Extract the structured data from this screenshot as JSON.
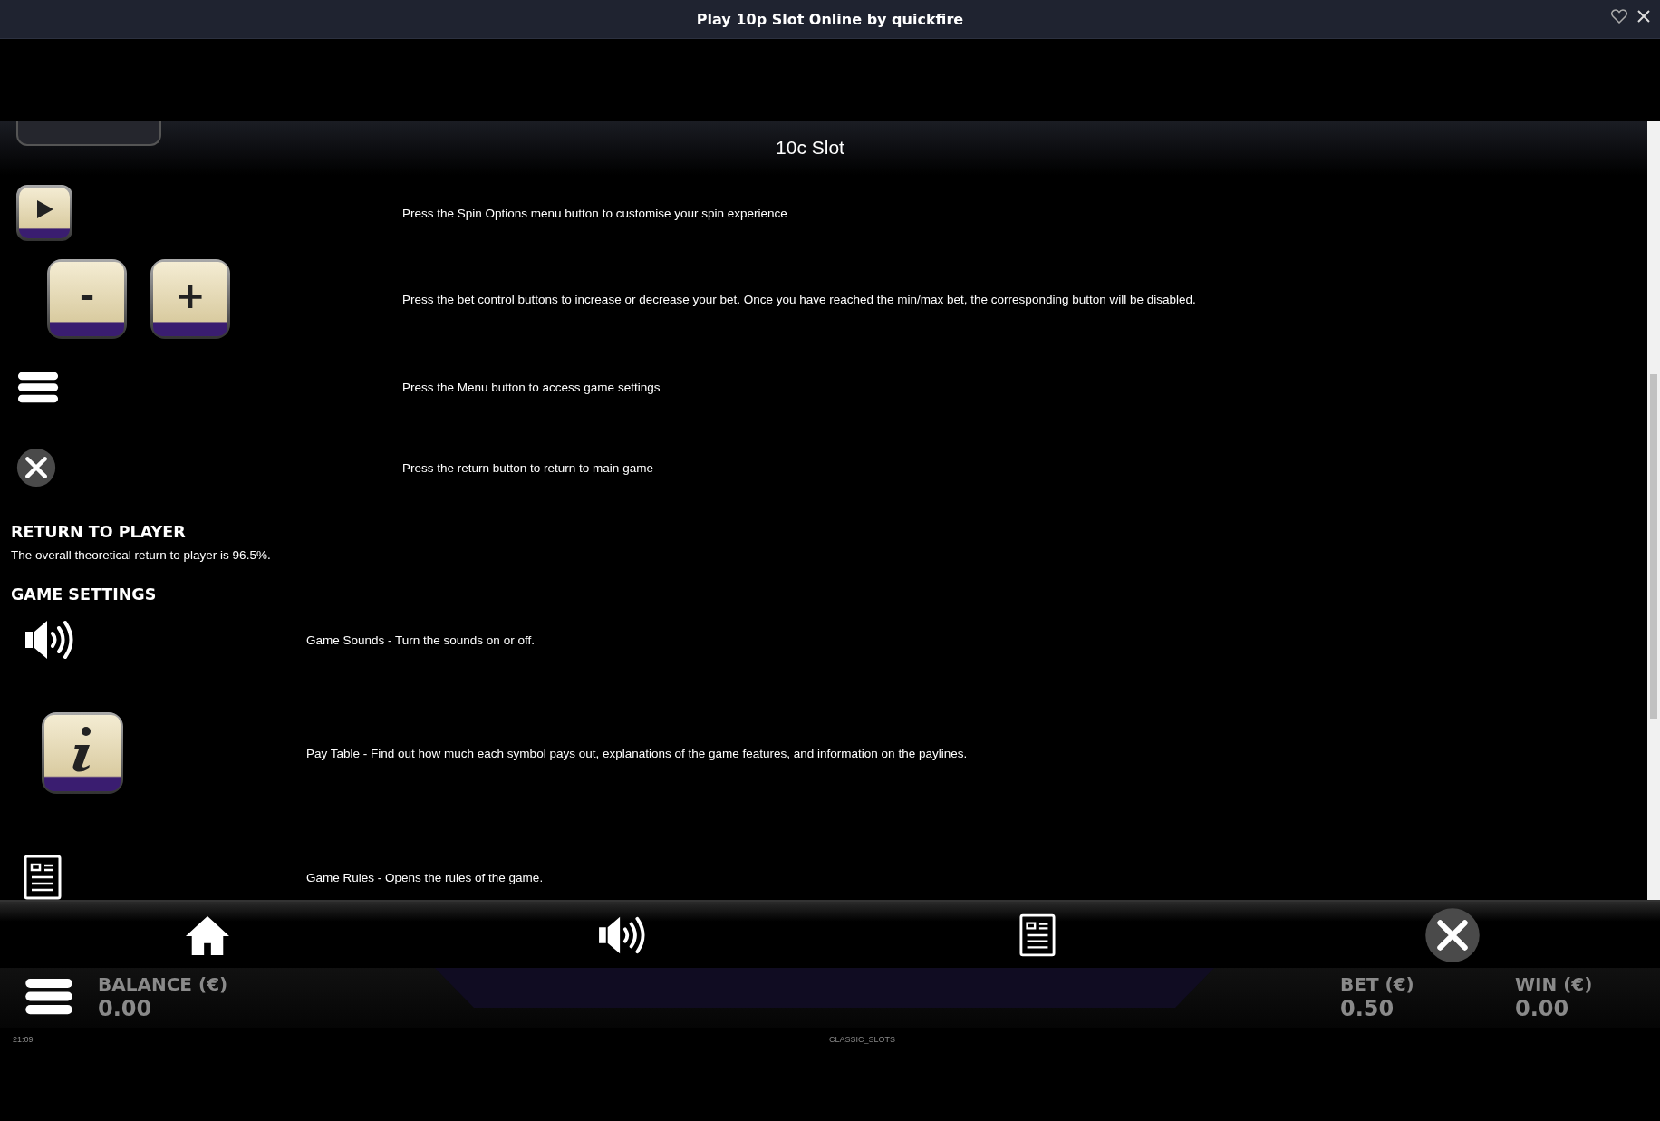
{
  "window": {
    "title": "Play 10p Slot Online by quickfire"
  },
  "help": {
    "title": "10c Slot",
    "controls": [
      {
        "kind": "spin",
        "text": "Press the Spin Options menu button to customise your spin experience"
      },
      {
        "kind": "bet",
        "text": "Press the bet control buttons to increase or decrease your bet. Once you have reached the min/max bet, the corresponding button will be disabled.",
        "minus": "-",
        "plus": "+"
      },
      {
        "kind": "menu",
        "text": "Press the Menu button to access game settings"
      },
      {
        "kind": "close",
        "text": "Press the return button to return to main game"
      }
    ],
    "rtp": {
      "heading": "RETURN TO PLAYER",
      "text": "The overall theoretical return to player is 96.5%."
    },
    "settings": {
      "heading": "GAME SETTINGS",
      "items": [
        {
          "kind": "sound",
          "text": "Game Sounds - Turn the sounds on or off."
        },
        {
          "kind": "info",
          "text": "Pay Table - Find out how much each symbol pays out, explanations of the game features, and information on the paylines."
        },
        {
          "kind": "rules",
          "text": "Game Rules - Opens the rules of the game."
        }
      ]
    }
  },
  "nav": [
    {
      "kind": "home"
    },
    {
      "kind": "sound"
    },
    {
      "kind": "rules"
    },
    {
      "kind": "close"
    }
  ],
  "status": {
    "balance_label": "BALANCE (€)",
    "balance": "0.00",
    "bet_label": "BET (€)",
    "bet": "0.50",
    "win_label": "WIN (€)",
    "win": "0.00"
  },
  "footer": {
    "time": "21:09",
    "game": "CLASSIC_SLOTS"
  }
}
